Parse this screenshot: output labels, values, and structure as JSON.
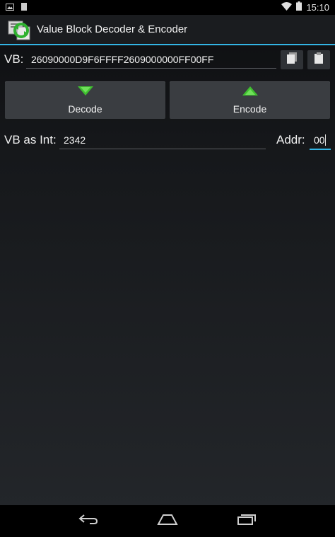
{
  "status_bar": {
    "time": "15:10",
    "icons": [
      "image-notification-icon",
      "sd-card-icon",
      "wifi-icon",
      "battery-icon"
    ]
  },
  "action_bar": {
    "title": "Value Block Decoder & Encoder",
    "icon": "app-logo-icon"
  },
  "vb": {
    "label": "VB:",
    "value": "26090000D9F6FFFF2609000000FF00FF",
    "copy_icon": "copy-icon",
    "paste_icon": "paste-icon"
  },
  "buttons": {
    "decode_label": "Decode",
    "encode_label": "Encode",
    "decode_icon": "arrow-down-icon",
    "encode_icon": "arrow-up-icon"
  },
  "int_row": {
    "label": "VB as Int:",
    "value": "2342",
    "addr_label": "Addr:",
    "addr_value": "00"
  },
  "nav_bar": {
    "icons": [
      "back-icon",
      "home-icon",
      "recents-icon"
    ]
  },
  "colors": {
    "accent": "#33b5e5",
    "green_arrow": "#3fbf2f",
    "button_bg": "#3a3d41"
  }
}
